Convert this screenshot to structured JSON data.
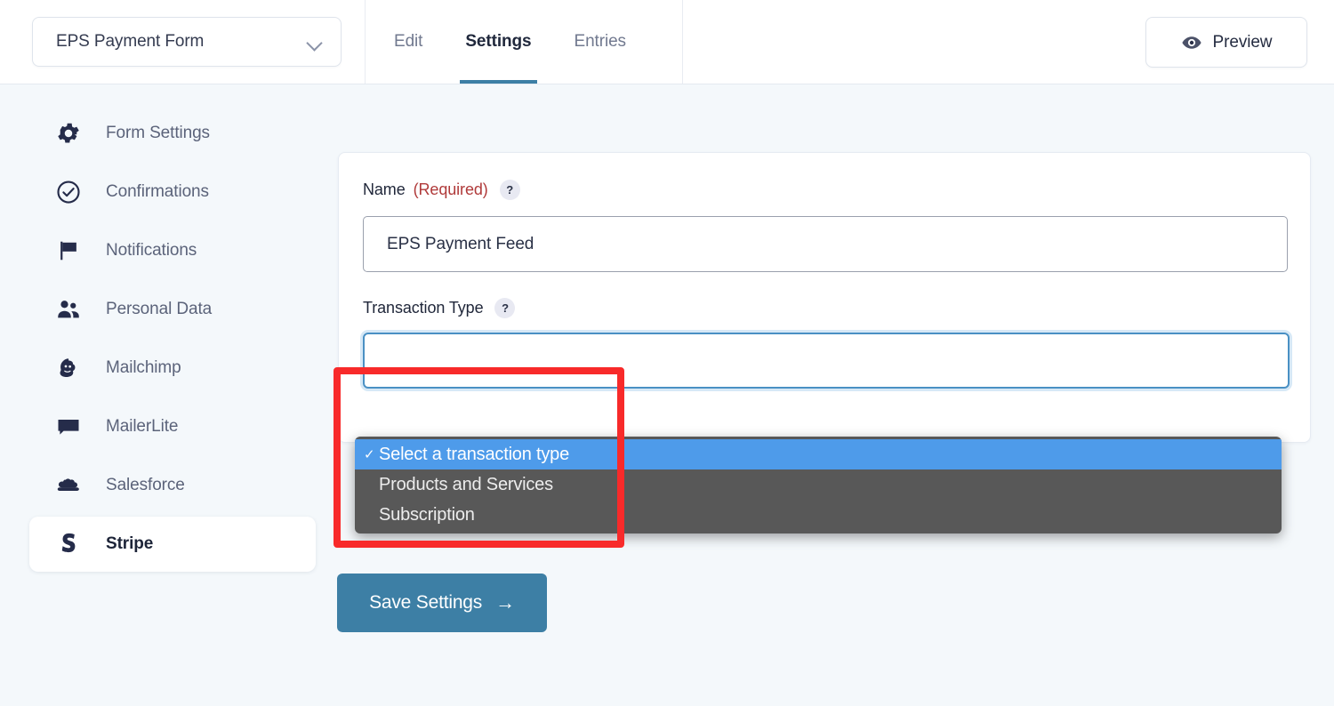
{
  "header": {
    "form_selector": {
      "value": "EPS Payment Form",
      "chevron_icon": "chevron-down-icon"
    },
    "tabs": [
      {
        "label": "Edit",
        "active": false
      },
      {
        "label": "Settings",
        "active": true
      },
      {
        "label": "Entries",
        "active": false
      }
    ],
    "preview": {
      "label": "Preview",
      "icon": "eye-icon"
    }
  },
  "sidebar": {
    "items": [
      {
        "label": "Form Settings",
        "icon": "gear-icon",
        "active": false
      },
      {
        "label": "Confirmations",
        "icon": "check-circle-icon",
        "active": false
      },
      {
        "label": "Notifications",
        "icon": "flag-icon",
        "active": false
      },
      {
        "label": "Personal Data",
        "icon": "people-icon",
        "active": false
      },
      {
        "label": "Mailchimp",
        "icon": "mailchimp-icon",
        "active": false
      },
      {
        "label": "MailerLite",
        "icon": "speech-bubble-icon",
        "active": false
      },
      {
        "label": "Salesforce",
        "icon": "cloud-icon",
        "active": false
      },
      {
        "label": "Stripe",
        "icon": "stripe-s-icon",
        "active": true
      }
    ]
  },
  "main": {
    "name_field": {
      "label": "Name",
      "required_text": "(Required)",
      "help_glyph": "?",
      "value": "EPS Payment Feed",
      "placeholder": ""
    },
    "transaction_type_field": {
      "label": "Transaction Type",
      "help_glyph": "?",
      "selected_value": "Select a transaction type",
      "options": [
        {
          "label": "Select a transaction type",
          "selected": true
        },
        {
          "label": "Products and Services",
          "selected": false
        },
        {
          "label": "Subscription",
          "selected": false
        }
      ],
      "check_glyph": "✓"
    },
    "save_button": {
      "label": "Save Settings",
      "arrow_glyph": "→"
    }
  },
  "annotation": {
    "shape": "rectangle",
    "color": "#f82a2a"
  },
  "colors": {
    "page_background": "#f4f8fb",
    "accent": "#3d7fa5",
    "dropdown_background": "#585858",
    "dropdown_highlight": "#4e9bea",
    "required_text": "#b03a3a",
    "annotation_red": "#f82a2a"
  }
}
